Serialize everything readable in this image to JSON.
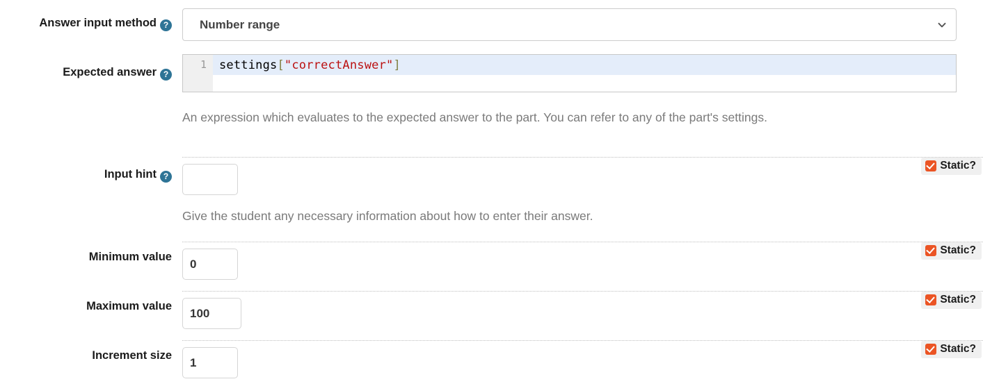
{
  "rows": {
    "answer_input_method": {
      "label": "Answer input method",
      "help_icon": "help-circle-icon",
      "value": "Number range",
      "chevron": "chevron-down-icon"
    },
    "expected_answer": {
      "label": "Expected answer",
      "help_icon": "help-circle-icon",
      "line_number": "1",
      "code": {
        "identifier": "settings",
        "open_bracket": "[",
        "string": "\"correctAnswer\"",
        "close_bracket": "]"
      },
      "description": "An expression which evaluates to the expected answer to the part. You can refer to any of the part's settings."
    },
    "input_hint": {
      "label": "Input hint",
      "help_icon": "help-circle-icon",
      "value": "",
      "placeholder": "",
      "description": "Give the student any necessary information about how to enter their answer.",
      "static_label": "Static?",
      "static_checked": true
    },
    "minimum_value": {
      "label": "Minimum value",
      "value": "0",
      "static_label": "Static?",
      "static_checked": true
    },
    "maximum_value": {
      "label": "Maximum value",
      "value": "100",
      "static_label": "Static?",
      "static_checked": true
    },
    "increment_size": {
      "label": "Increment size",
      "value": "1",
      "static_label": "Static?",
      "static_checked": true
    }
  },
  "colors": {
    "help_icon": "#2e7496",
    "checkbox": "#eb5424",
    "code_string": "#bb1111",
    "code_bracket": "#7f7f3f",
    "active_line": "#e4edfa",
    "label_text": "#1b1b1b",
    "hint_text": "#7a7a7a"
  }
}
